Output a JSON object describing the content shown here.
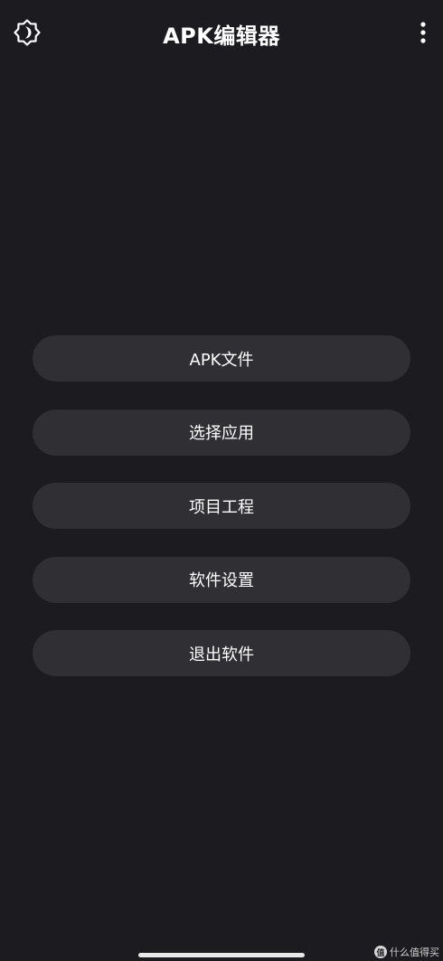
{
  "app_bar": {
    "title": "APK编辑器",
    "left_icon": "brightness-auto-icon",
    "right_icon": "more-vert-icon"
  },
  "menu": {
    "items": [
      {
        "label": "APK文件"
      },
      {
        "label": "选择应用"
      },
      {
        "label": "项目工程"
      },
      {
        "label": "软件设置"
      },
      {
        "label": "退出软件"
      }
    ]
  },
  "watermark": {
    "logo": "值",
    "text": "什么值得买"
  },
  "colors": {
    "background": "#1c1b1f",
    "button": "#302f33",
    "text": "#ffffff"
  }
}
